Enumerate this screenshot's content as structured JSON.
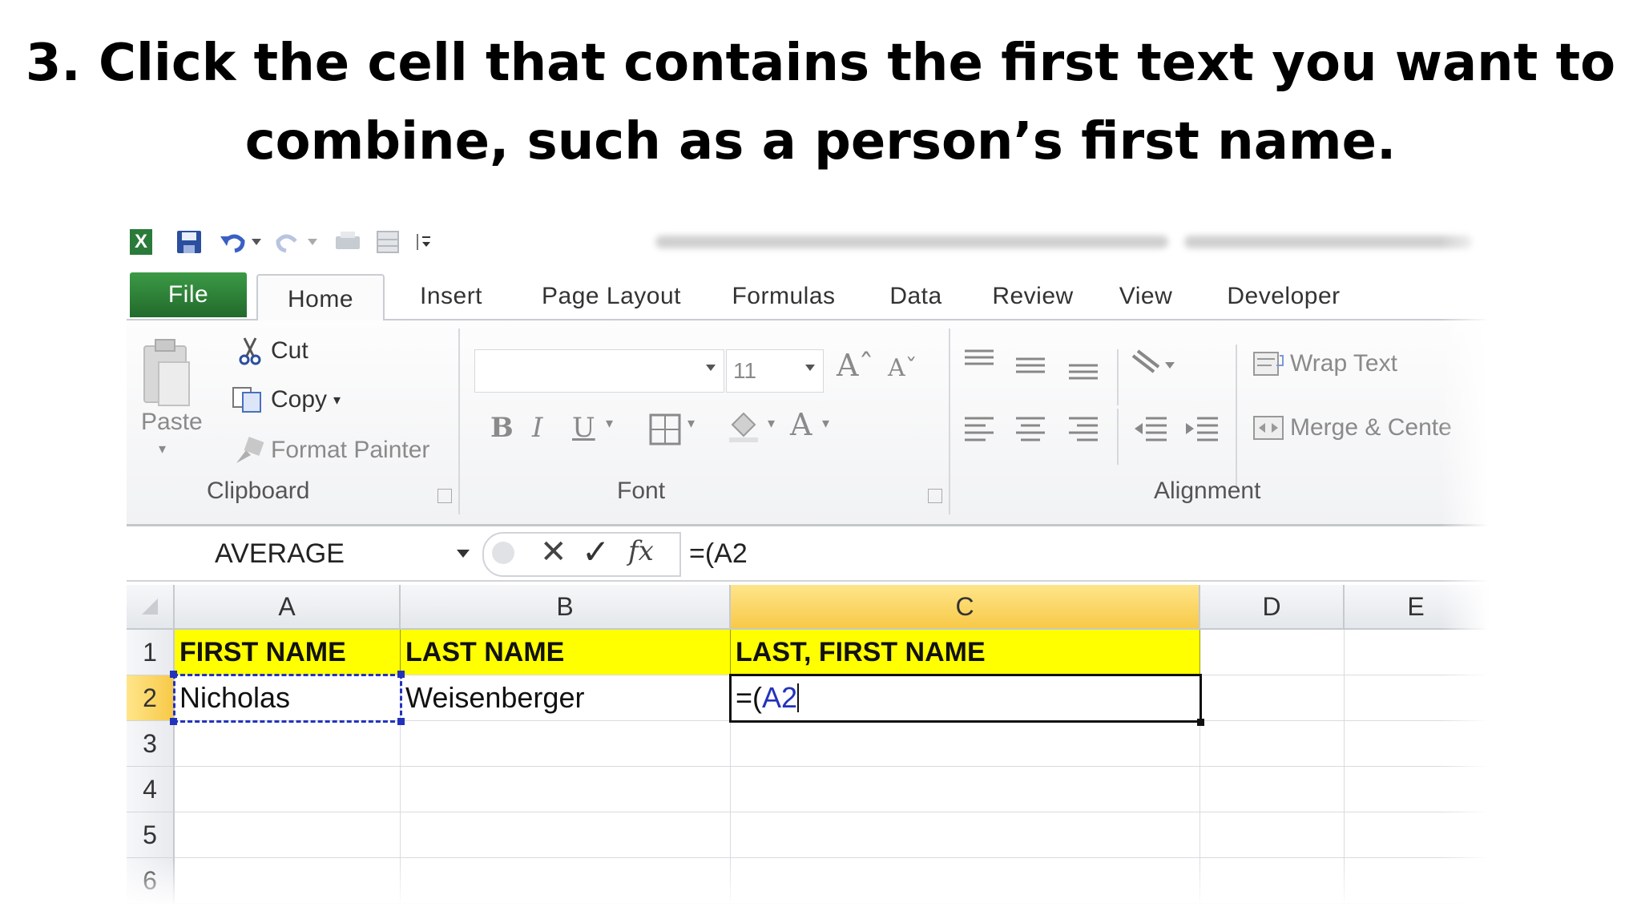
{
  "heading": {
    "line1": "3. Click the cell that contains the first text you want to",
    "line2": "combine, such as a person’s first name."
  },
  "tabs": [
    {
      "label": "File"
    },
    {
      "label": "Home"
    },
    {
      "label": "Insert"
    },
    {
      "label": "Page Layout"
    },
    {
      "label": "Formulas"
    },
    {
      "label": "Data"
    },
    {
      "label": "Review"
    },
    {
      "label": "View"
    },
    {
      "label": "Developer"
    }
  ],
  "clipboard": {
    "paste": "Paste",
    "cut": "Cut",
    "copy": "Copy",
    "format_painter": "Format Painter",
    "group": "Clipboard"
  },
  "font": {
    "size": "11",
    "bold": "B",
    "italic": "I",
    "underline": "U",
    "group": "Font"
  },
  "alignment": {
    "wrap_text": "Wrap Text",
    "merge": "Merge & Cente",
    "group": "Alignment"
  },
  "formula_bar": {
    "name_box": "AVERAGE",
    "formula": "=(A2"
  },
  "columns": [
    "A",
    "B",
    "C",
    "D",
    "E"
  ],
  "rows": [
    "1",
    "2",
    "3",
    "4",
    "5",
    "6"
  ],
  "cells": {
    "A1": "FIRST NAME",
    "B1": "LAST NAME",
    "C1": "LAST, FIRST NAME",
    "A2": "Nicholas",
    "B2": "Weisenberger",
    "C2_prefix": "=(",
    "C2_ref": "A2"
  },
  "colors": {
    "header_fill": "#ffff00",
    "file_tab": "#2e8b3a",
    "active_header": "#f7c948",
    "reference_blue": "#2233bb"
  }
}
